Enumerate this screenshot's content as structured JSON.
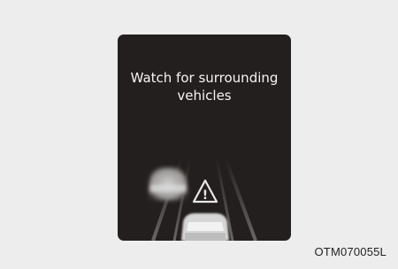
{
  "display": {
    "message_line1": "Watch for surrounding",
    "message_line2": "vehicles",
    "warning_symbol": "!",
    "colors": {
      "background": "#231f1e",
      "text": "#f5f5f5",
      "lane_lines": "#5a5654",
      "vehicle": "#d6d6d6"
    },
    "icons": [
      "warning-triangle-icon",
      "surrounding-vehicle-icon",
      "own-vehicle-icon"
    ]
  },
  "figure_code": "OTM070055L",
  "page_background": "#ededed"
}
